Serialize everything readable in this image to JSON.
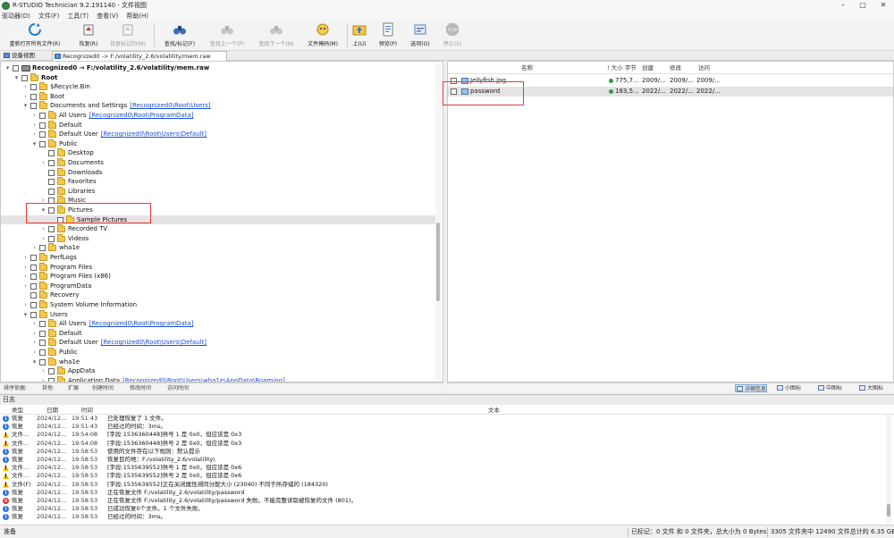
{
  "window": {
    "title": "R-STUDIO Technician 9.2.191140 - 文件视图",
    "controls": {
      "minimize": "–",
      "maximize": "▢",
      "close": "✕"
    }
  },
  "menu": [
    "驱动器(D)",
    "文件(F)",
    "工具(T)",
    "查看(V)",
    "帮助(H)"
  ],
  "toolbar": [
    {
      "label": "重新打开所有文件(R)",
      "icon": "refresh-icon",
      "enabled": true
    },
    {
      "label": "恢复(R)",
      "icon": "recover-icon",
      "enabled": true
    },
    {
      "label": "恢复标记的(M)",
      "icon": "recover-marked-icon",
      "enabled": false
    },
    {
      "label": "查找/标记(F)",
      "icon": "binoculars-icon",
      "enabled": true
    },
    {
      "label": "查找上一个(P)",
      "icon": "find-prev-icon",
      "enabled": false
    },
    {
      "label": "查找下一个(N)",
      "icon": "find-next-icon",
      "enabled": false
    },
    {
      "label": "文件掩码(M)",
      "icon": "file-mask-icon",
      "enabled": true
    },
    {
      "label": "上(U)",
      "icon": "folder-up-icon",
      "enabled": true
    },
    {
      "label": "预览(P)",
      "icon": "preview-icon",
      "enabled": true
    },
    {
      "label": "选项(O)",
      "icon": "options-icon",
      "enabled": true
    },
    {
      "label": "停止(S)",
      "icon": "stop-icon",
      "enabled": false
    }
  ],
  "stop_icon_text": "STOP",
  "tabs": [
    {
      "label": "设备视图",
      "active": false
    },
    {
      "label": "Recognized0 -> F:/volatility_2.6/volatility/mem.raw",
      "active": true
    }
  ],
  "tree": [
    {
      "level": 0,
      "expander": "▾",
      "checkbox": true,
      "icon": "drive",
      "name": "Recognized0 → F:/volatility_2.6/volatility/mem.raw",
      "bold": true
    },
    {
      "level": 1,
      "expander": "▾",
      "checkbox": true,
      "icon": "folder",
      "name": "Root",
      "bold": true
    },
    {
      "level": 2,
      "expander": "›",
      "checkbox": true,
      "icon": "folder",
      "name": "$Recycle.Bin"
    },
    {
      "level": 2,
      "expander": "›",
      "checkbox": true,
      "icon": "folder",
      "name": "Boot"
    },
    {
      "level": 2,
      "expander": "▾",
      "checkbox": true,
      "icon": "folder",
      "name": "Documents and Settings",
      "link": "[Recognized0\\Root\\Users]"
    },
    {
      "level": 3,
      "expander": "›",
      "checkbox": true,
      "icon": "folder",
      "name": "All Users",
      "link": "[Recognized0\\Root\\ProgramData]"
    },
    {
      "level": 3,
      "expander": "›",
      "checkbox": true,
      "icon": "folder",
      "name": "Default"
    },
    {
      "level": 3,
      "expander": "›",
      "checkbox": true,
      "icon": "folder",
      "name": "Default User",
      "link": "[Recognized0\\Root\\Users\\Default]"
    },
    {
      "level": 3,
      "expander": "▾",
      "checkbox": true,
      "icon": "folder",
      "name": "Public"
    },
    {
      "level": 4,
      "expander": "",
      "checkbox": true,
      "icon": "folder",
      "name": "Desktop"
    },
    {
      "level": 4,
      "expander": "›",
      "checkbox": true,
      "icon": "folder",
      "name": "Documents"
    },
    {
      "level": 4,
      "expander": "",
      "checkbox": true,
      "icon": "folder",
      "name": "Downloads"
    },
    {
      "level": 4,
      "expander": "",
      "checkbox": true,
      "icon": "folder",
      "name": "Favorites"
    },
    {
      "level": 4,
      "expander": "",
      "checkbox": true,
      "icon": "folder",
      "name": "Libraries"
    },
    {
      "level": 4,
      "expander": "›",
      "checkbox": true,
      "icon": "folder",
      "name": "Music"
    },
    {
      "level": 4,
      "expander": "▾",
      "checkbox": true,
      "icon": "folder",
      "name": "Pictures"
    },
    {
      "level": 5,
      "expander": "",
      "checkbox": true,
      "icon": "folder",
      "name": "Sample Pictures",
      "selected": true
    },
    {
      "level": 4,
      "expander": "›",
      "checkbox": true,
      "icon": "folder",
      "name": "Recorded TV"
    },
    {
      "level": 4,
      "expander": "›",
      "checkbox": true,
      "icon": "folder",
      "name": "Videos"
    },
    {
      "level": 3,
      "expander": "›",
      "checkbox": true,
      "icon": "folder",
      "name": "wha1e"
    },
    {
      "level": 2,
      "expander": "›",
      "checkbox": true,
      "icon": "folder",
      "name": "PerfLogs"
    },
    {
      "level": 2,
      "expander": "›",
      "checkbox": true,
      "icon": "folder",
      "name": "Program Files"
    },
    {
      "level": 2,
      "expander": "›",
      "checkbox": true,
      "icon": "folder",
      "name": "Program Files (x86)"
    },
    {
      "level": 2,
      "expander": "›",
      "checkbox": true,
      "icon": "folder",
      "name": "ProgramData"
    },
    {
      "level": 2,
      "expander": "",
      "checkbox": true,
      "icon": "folder",
      "name": "Recovery"
    },
    {
      "level": 2,
      "expander": "›",
      "checkbox": true,
      "icon": "folder",
      "name": "System Volume Information"
    },
    {
      "level": 2,
      "expander": "▾",
      "checkbox": true,
      "icon": "folder",
      "name": "Users"
    },
    {
      "level": 3,
      "expander": "›",
      "checkbox": true,
      "icon": "folder",
      "name": "All Users",
      "link": "[Recognized0\\Root\\ProgramData]"
    },
    {
      "level": 3,
      "expander": "›",
      "checkbox": true,
      "icon": "folder",
      "name": "Default"
    },
    {
      "level": 3,
      "expander": "›",
      "checkbox": true,
      "icon": "folder",
      "name": "Default User",
      "link": "[Recognized0\\Root\\Users\\Default]"
    },
    {
      "level": 3,
      "expander": "›",
      "checkbox": true,
      "icon": "folder",
      "name": "Public"
    },
    {
      "level": 3,
      "expander": "▾",
      "checkbox": true,
      "icon": "folder",
      "name": "wha1e"
    },
    {
      "level": 4,
      "expander": "›",
      "checkbox": true,
      "icon": "folder",
      "name": "AppData"
    },
    {
      "level": 4,
      "expander": "›",
      "checkbox": true,
      "icon": "folder",
      "name": "Application Data",
      "link": "[Recognized0\\Root\\Users\\wha1e\\AppData\\Roaming]"
    }
  ],
  "sortbar": [
    "排序依据:",
    "其他",
    "扩展",
    "创建时间",
    "修改时间",
    "访问时间"
  ],
  "file_columns": [
    "名称",
    "! 大小 字节",
    "创建",
    "修改",
    "访问"
  ],
  "files": [
    {
      "name": "Jellyfish.jpg",
      "size": "775,7...",
      "created": "2009/...",
      "modified": "2009/...",
      "accessed": "2009/...",
      "selected": false
    },
    {
      "name": "password",
      "size": "183,5...",
      "created": "2022/...",
      "modified": "2022/...",
      "accessed": "2022/...",
      "selected": true
    }
  ],
  "view_buttons": [
    {
      "label": "详细信息",
      "active": true
    },
    {
      "label": "小图标",
      "active": false
    },
    {
      "label": "中图标",
      "active": false
    },
    {
      "label": "大图标",
      "active": false
    }
  ],
  "log": {
    "title": "日志",
    "columns": [
      "类型",
      "日期",
      "时间",
      "文本"
    ],
    "rows": [
      {
        "level": "info",
        "type": "恢复",
        "date": "2024/12...",
        "time": "19:51:43",
        "text": "已处理恢复了 1 文件。"
      },
      {
        "level": "info",
        "type": "恢复",
        "date": "2024/12...",
        "time": "19:51:43",
        "text": "已经过的时间：3ms。"
      },
      {
        "level": "warn",
        "type": "文件...",
        "date": "2024/12...",
        "time": "19:54:08",
        "text": "[字段:1536360448]供号 1 是 0x0，但应该是 0x3"
      },
      {
        "level": "warn",
        "type": "文件...",
        "date": "2024/12...",
        "time": "19:54:08",
        "text": "[字段:1536360448]供号 2 是 0x0，但应该是 0x3"
      },
      {
        "level": "info",
        "type": "恢复",
        "date": "2024/12...",
        "time": "19:58:53",
        "text": "使用的文件存在以下规则：默认提示"
      },
      {
        "level": "info",
        "type": "恢复",
        "date": "2024/12...",
        "time": "19:58:53",
        "text": "恢复目的地：F:/volatility_2.6/volatility\\"
      },
      {
        "level": "warn",
        "type": "文件...",
        "date": "2024/12...",
        "time": "19:58:53",
        "text": "[字段:1535639552]供号 1 是 0x0，但应该是 0x6"
      },
      {
        "level": "warn",
        "type": "文件...",
        "date": "2024/12...",
        "time": "19:58:53",
        "text": "[字段:1535639552]供号 2 是 0x0，但应该是 0x6"
      },
      {
        "level": "warn",
        "type": "文件(F)",
        "date": "2024/12...",
        "time": "19:58:53",
        "text": "[字段:1535639552]正在关闭属性溯同分配大小 (23040) 不同于所存储的 (184320)"
      },
      {
        "level": "info",
        "type": "恢复",
        "date": "2024/12...",
        "time": "19:58:53",
        "text": "正在恢复文件 F:/volatility_2.6/volatility/password"
      },
      {
        "level": "error",
        "type": "恢复",
        "date": "2024/12...",
        "time": "19:58:53",
        "text": "正在恢复文件 F:/volatility_2.6/volatility/password 失败。不能完整读取被恢复的文件 (801)。"
      },
      {
        "level": "info",
        "type": "恢复",
        "date": "2024/12...",
        "time": "19:58:53",
        "text": "已成功恢复0个文件。1 个文件失败。"
      },
      {
        "level": "info",
        "type": "恢复",
        "date": "2024/12...",
        "time": "19:58:53",
        "text": "已经过的时间：3ms。"
      }
    ]
  },
  "status": {
    "left": "准备",
    "marked": "已标记：0 文件 和 0 文件夹，总大小为 0 Bytes",
    "total": "3305 文件夹中 12490 文件总计的 6.35 GB"
  },
  "colors": {
    "accent": "#2f6fd6",
    "folder": "#f2c94c",
    "highlight": "#e53935",
    "link": "#1b4fd6"
  }
}
